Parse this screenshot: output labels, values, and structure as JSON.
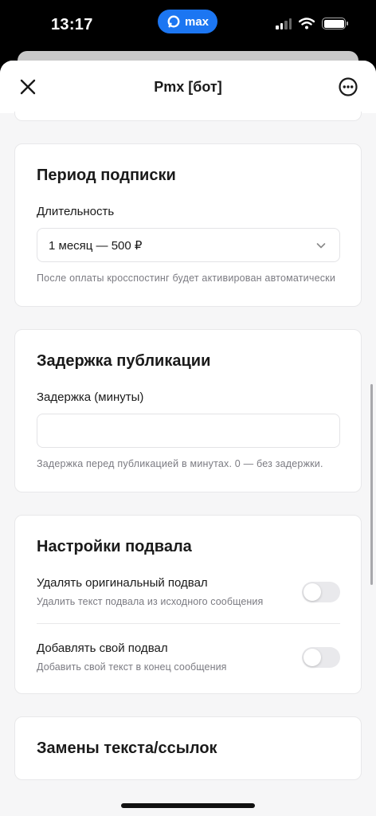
{
  "status_bar": {
    "time": "13:17",
    "app_pill_label": "max",
    "icons": [
      "signal-icon",
      "wifi-icon",
      "battery-icon"
    ]
  },
  "header": {
    "title": "Pmx [бот]",
    "close_icon": "close-icon",
    "more_icon": "more-icon"
  },
  "subscription": {
    "title": "Период подписки",
    "duration_label": "Длительность",
    "duration_value": "1 месяц — 500 ₽",
    "hint": "После оплаты кросспостинг будет активирован автоматически"
  },
  "delay": {
    "title": "Задержка публикации",
    "label": "Задержка (минуты)",
    "value": "",
    "hint": "Задержка перед публикацией в минутах. 0 — без задержки."
  },
  "footer_settings": {
    "title": "Настройки подвала",
    "remove_original": {
      "label": "Удалять оригинальный подвал",
      "description": "Удалить текст подвала из исходного сообщения",
      "enabled": false
    },
    "add_custom": {
      "label": "Добавлять свой подвал",
      "description": "Добавить свой текст в конец сообщения",
      "enabled": false
    }
  },
  "replacements": {
    "title": "Замены текста/ссылок"
  },
  "colors": {
    "accent": "#1c76f2",
    "background": "#f6f6f7",
    "card": "#ffffff",
    "muted_text": "#7b7b82"
  }
}
